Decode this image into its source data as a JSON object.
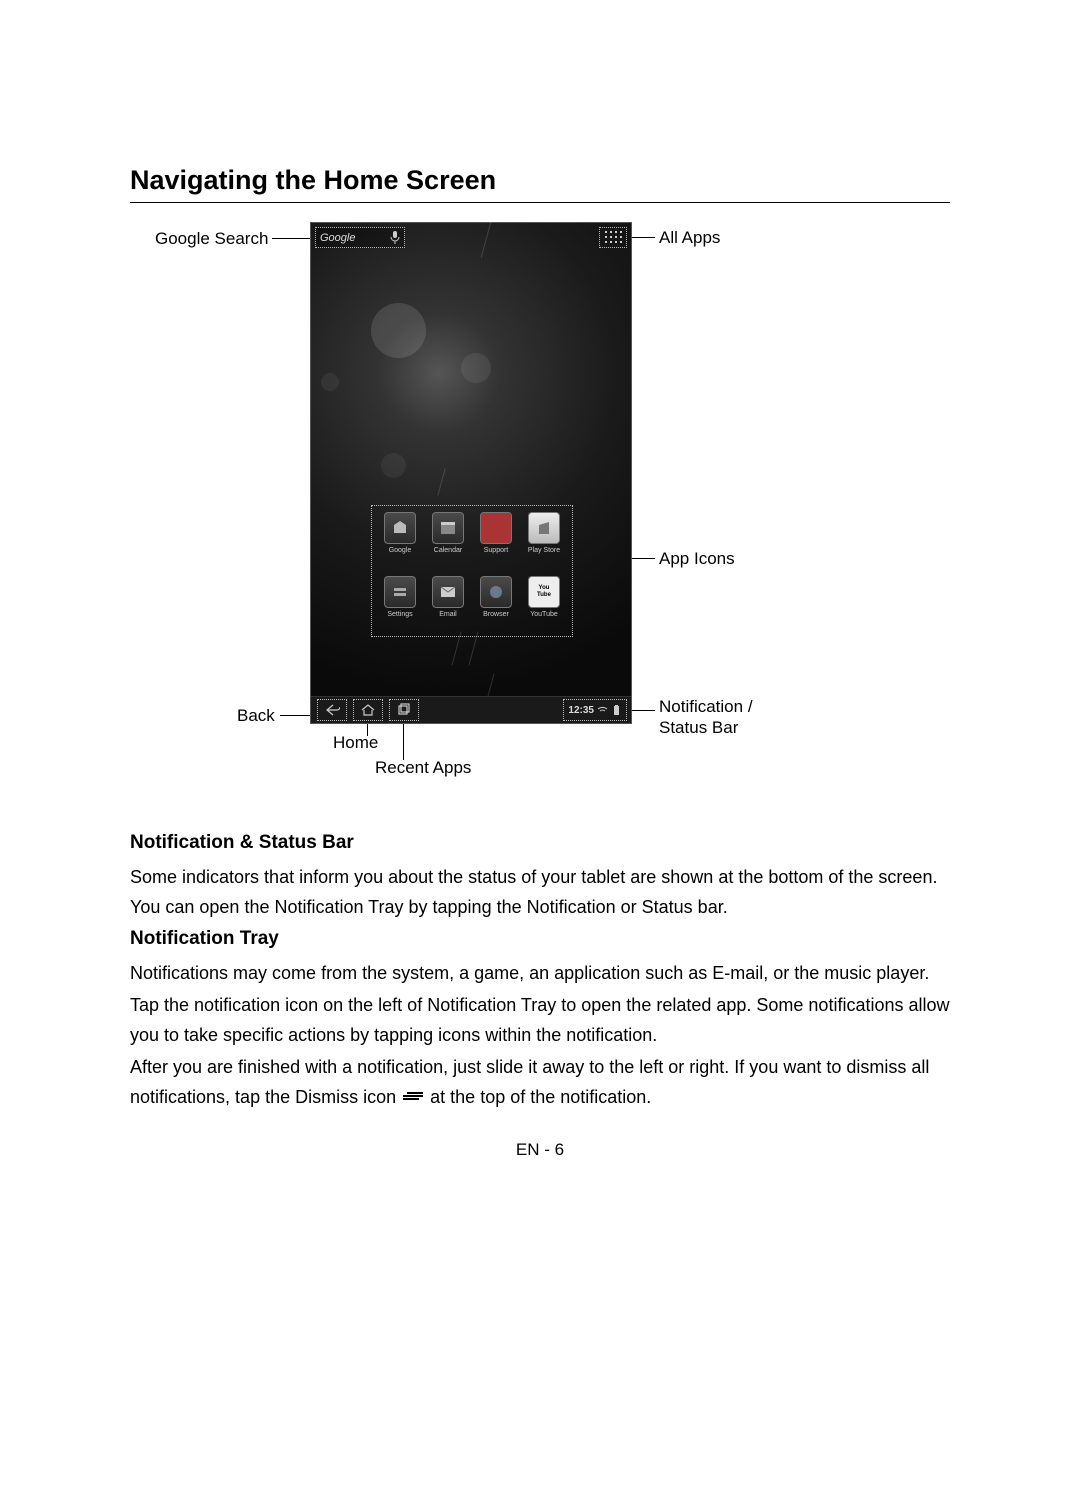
{
  "title": "Navigating the Home Screen",
  "callouts": {
    "google_search": "Google Search",
    "all_apps": "All Apps",
    "app_icons": "App Icons",
    "back": "Back",
    "home": "Home",
    "recent": "Recent Apps",
    "status_bar_l1": "Notification /",
    "status_bar_l2": "Status Bar"
  },
  "tablet": {
    "search_label": "Google",
    "clock": "12:35",
    "apps_row1": [
      "Google",
      "Calendar",
      "Support",
      "Play Store"
    ],
    "apps_row2": [
      "Settings",
      "Email",
      "Browser",
      "YouTube"
    ]
  },
  "sections": {
    "s1_head": "Notification & Status Bar",
    "s1_body": "Some indicators that inform you about the status of your tablet are shown at the bottom of the screen. You can open the Notification Tray by tapping the Notification or Status bar.",
    "s2_head": "Notification Tray",
    "s2_body1": "Notifications may come from the system, a game, an application such as E-mail, or the music player.",
    "s2_body2": "Tap the notification icon on the left of Notification Tray to open the related app. Some notifications allow you to take specific actions by tapping icons within the notification.",
    "s2_body3a": "After you are finished with a notification, just slide it away to the left or right. If you want to dismiss all notifications, tap the Dismiss icon",
    "s2_body3b": "at the top of the notification."
  },
  "footer": "EN - 6"
}
